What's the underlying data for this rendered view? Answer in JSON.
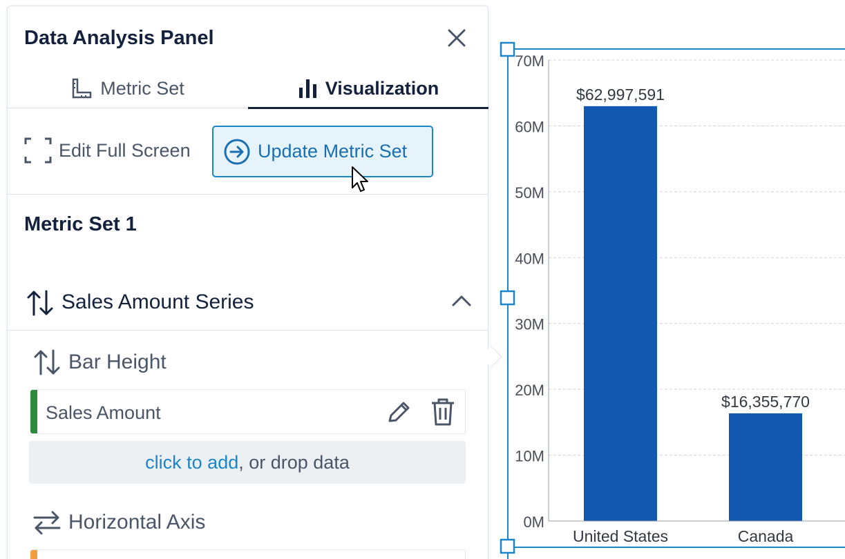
{
  "panel": {
    "title": "Data Analysis Panel",
    "tabs": [
      {
        "label": "Metric Set",
        "icon": "ruler-icon",
        "active": false
      },
      {
        "label": "Visualization",
        "icon": "bar-chart-icon",
        "active": true
      }
    ],
    "toolbar": {
      "fullscreen_label": "Edit Full Screen",
      "update_label": "Update Metric Set"
    },
    "metric_set_title": "Metric Set 1",
    "series": {
      "title": "Sales Amount Series",
      "expanded": true,
      "bar_height_label": "Bar Height",
      "fields": [
        {
          "name": "Sales Amount",
          "accent": "#2e8b3e"
        }
      ],
      "drop_link": "click to add",
      "drop_rest": ", or drop data",
      "horizontal_axis_label": "Horizontal Axis",
      "horizontal_field_accent": "#f0a040"
    }
  },
  "colors": {
    "bar": "#1258b0",
    "selection": "#1a86c8",
    "accent_link": "#1a86c8"
  },
  "chart_data": {
    "type": "bar",
    "categories": [
      "United States",
      "Canada"
    ],
    "values": [
      62997591,
      16355770
    ],
    "data_labels": [
      "$62,997,591",
      "$16,355,770"
    ],
    "y_ticks": [
      "0M",
      "10M",
      "20M",
      "30M",
      "40M",
      "50M",
      "60M",
      "70M"
    ],
    "ylim": [
      0,
      70000000
    ],
    "grid": true
  }
}
